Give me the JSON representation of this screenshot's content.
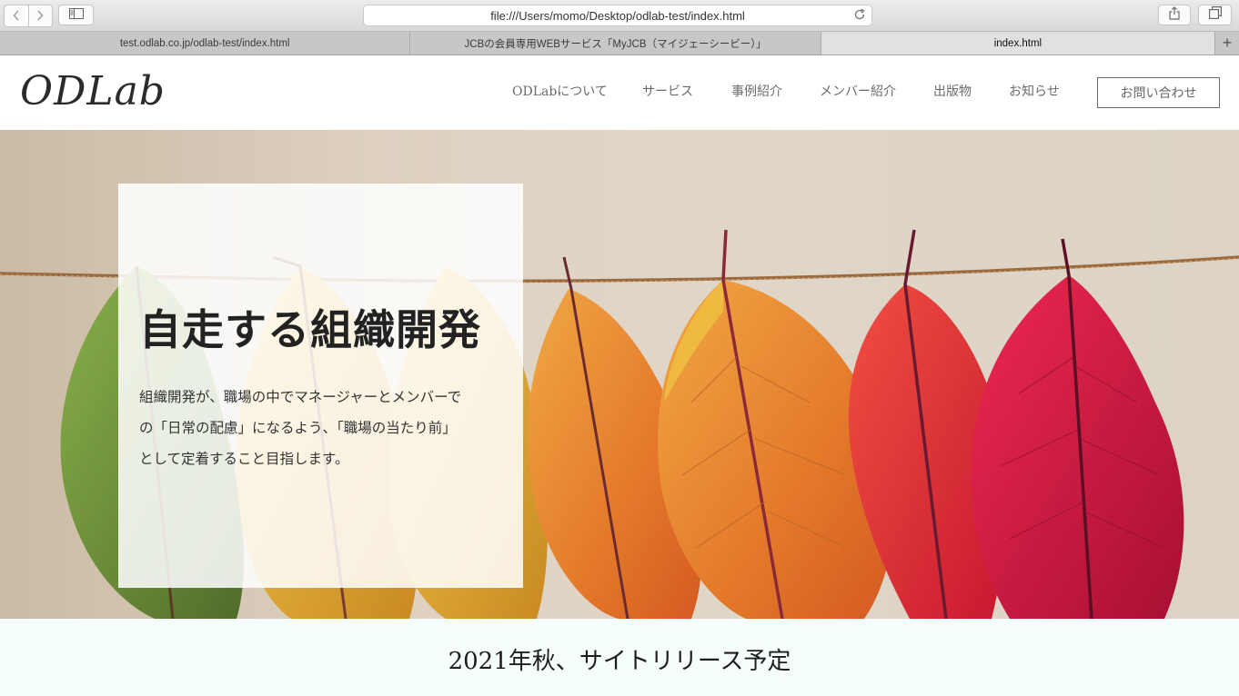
{
  "browser": {
    "url": "file:///Users/momo/Desktop/odlab-test/index.html",
    "tabs": [
      {
        "label": "test.odlab.co.jp/odlab-test/index.html",
        "active": false
      },
      {
        "label": "JCBの会員専用WEBサービス「MyJCB（マイジェーシービー）」",
        "active": false
      },
      {
        "label": "index.html",
        "active": true
      }
    ],
    "new_tab_symbol": "+",
    "icons": {
      "back": "chevron-left-icon",
      "forward": "chevron-right-icon",
      "sidebar": "sidebar-icon",
      "reload": "reload-icon",
      "share": "share-icon",
      "tabs": "tabs-overview-icon"
    }
  },
  "site": {
    "logo": "ODLab",
    "nav": [
      "ODLabについて",
      "サービス",
      "事例紹介",
      "メンバー紹介",
      "出版物",
      "お知らせ"
    ],
    "contact_button": "お問い合わせ",
    "hero": {
      "title": "自走する組織開発",
      "description": [
        "組織開発が、職場の中でマネージャーとメンバーで",
        "の「日常の配慮」になるよう、「職場の当たり前」",
        "として定着すること目指します。"
      ]
    },
    "release_notice": "2021年秋、サイトリリース予定"
  },
  "colors": {
    "nav_text": "#6b6b6b",
    "release_band": "#f6fdfd",
    "leaf_green": "#6f9a3a",
    "leaf_yellow": "#e8b030",
    "leaf_orange": "#e58a2e",
    "leaf_red": "#e0203e",
    "leaf_crimson": "#d2143f"
  }
}
